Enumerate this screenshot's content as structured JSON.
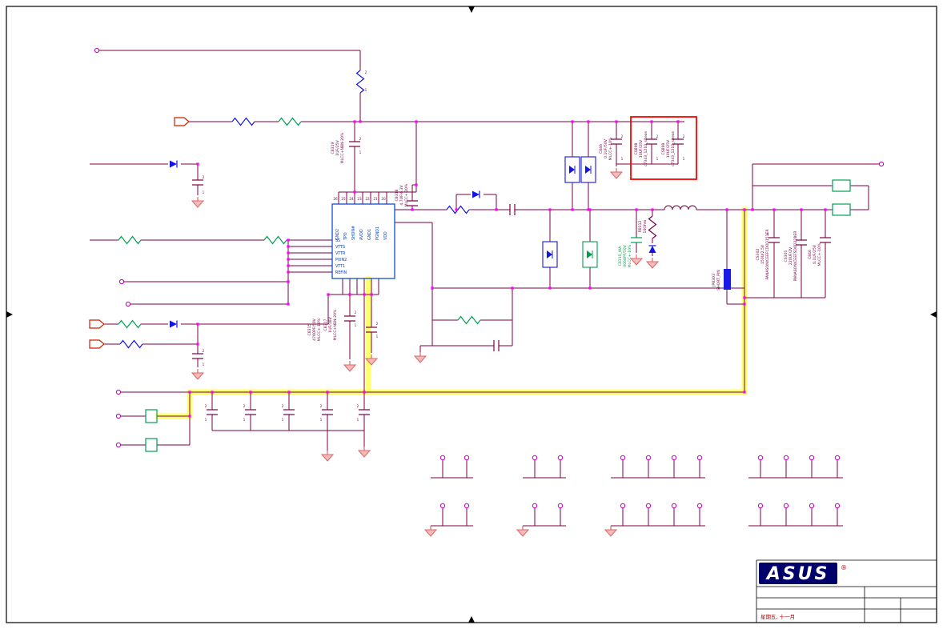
{
  "colors": {
    "wire": "#7a0045",
    "junction": "#ff00ff",
    "component_blue": "#1414e6",
    "component_green": "#00a050",
    "ic_blue": "#0040c8",
    "highlight_red": "#ff0000",
    "highlight_yellow": "#ffff70",
    "ground": "#dd6666",
    "logo_bg": "#00006b"
  },
  "pins": {
    "two": "2",
    "one": "1",
    "plus": "+"
  },
  "ic": {
    "top_nums": [
      "26",
      "25",
      "24",
      "23",
      "22",
      "21",
      "20"
    ],
    "top_pins": [
      "GND2",
      "TPO",
      "SHDN#",
      "AVDD",
      "GND1",
      "PGND1",
      "VDD"
    ],
    "left_pins": [
      "SS",
      "VTTS",
      "VTTR",
      "PVIN2",
      "VTT1",
      "REFIN"
    ]
  },
  "components": {
    "c8319": {
      "ref": "C8319",
      "value": "1UF/25V",
      "spec": "MLCC+NBN-20%"
    },
    "c8318": {
      "ref": "C8318",
      "value": "4.7UF/6.3V",
      "spec": "MLCC+-20%"
    },
    "c846l": {
      "ref": "C846",
      "value": "0.1UF/50V",
      "spec": "MLCC+-10%"
    },
    "cs898": {
      "ref": "CS898",
      "value": "10UF/25V",
      "spec": "c7343_1210_siteas"
    },
    "cs899": {
      "ref": "CS899",
      "value": "10UF/25V",
      "spec": "c7343_1210_siteas"
    },
    "r8312": {
      "ref": "R8312",
      "value": "16Ohm"
    },
    "c8310": {
      "ref": "C8310_WA",
      "value": "0068PF/50V",
      "spec": "MLCC+-10%"
    },
    "jp8303": {
      "ref": "JP8303",
      "value": "SHORT_PIN"
    },
    "cs302": {
      "ref": "CS302",
      "value": "150U/2.5V",
      "spec": "PANASONICEEFCD0D151ER"
    },
    "cs301": {
      "ref": "CS301",
      "value": "220UF/2V",
      "spec": "PANASONICEEFSD0D221ER"
    },
    "c846r": {
      "ref": "C846",
      "value": "0.1UF/25V",
      "spec": "MLCC+-10%"
    },
    "c8317": {
      "ref": "C8317",
      "value": "1UF/16V",
      "spec": "MLCC+NBN-20%"
    },
    "c8315": {
      "ref": "C8315",
      "value": "4700PF/50V",
      "spec": "MLCC+-10%"
    }
  },
  "title_block": {
    "logo": "ASUS",
    "reg": "®",
    "note": "星期五, 十一月"
  }
}
